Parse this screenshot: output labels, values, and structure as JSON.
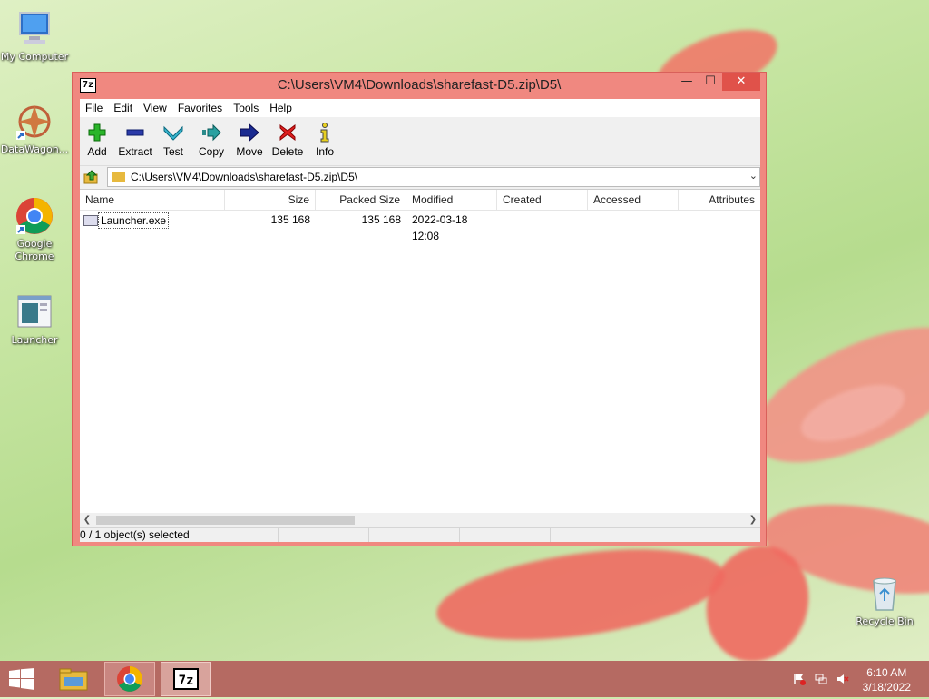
{
  "desktop": {
    "icons": [
      {
        "label": "My Computer"
      },
      {
        "label": "DataWagon..."
      },
      {
        "label": "Google Chrome"
      },
      {
        "label": "Launcher"
      },
      {
        "label": "Recycle Bin"
      }
    ]
  },
  "window": {
    "title": "C:\\Users\\VM4\\Downloads\\sharefast-D5.zip\\D5\\",
    "app_icon_text": "7z",
    "controls": {
      "minimize": "—",
      "maximize": "☐",
      "close": "✕"
    }
  },
  "menu": [
    "File",
    "Edit",
    "View",
    "Favorites",
    "Tools",
    "Help"
  ],
  "toolbar": [
    {
      "label": "Add",
      "icon": "plus-icon"
    },
    {
      "label": "Extract",
      "icon": "minus-icon"
    },
    {
      "label": "Test",
      "icon": "check-icon"
    },
    {
      "label": "Copy",
      "icon": "copy-arrow-icon"
    },
    {
      "label": "Move",
      "icon": "move-arrow-icon"
    },
    {
      "label": "Delete",
      "icon": "delete-x-icon"
    },
    {
      "label": "Info",
      "icon": "info-icon"
    }
  ],
  "address": {
    "path": "C:\\Users\\VM4\\Downloads\\sharefast-D5.zip\\D5\\"
  },
  "columns": [
    "Name",
    "Size",
    "Packed Size",
    "Modified",
    "Created",
    "Accessed",
    "Attributes"
  ],
  "rows": [
    {
      "name": "Launcher.exe",
      "size": "135 168",
      "packed": "135 168",
      "modified": "2022-03-18 12:08",
      "created": "",
      "accessed": "",
      "attributes": ""
    }
  ],
  "status": {
    "selection": "0 / 1 object(s) selected"
  },
  "taskbar": {
    "time": "6:10 AM",
    "date": "3/18/2022",
    "apps": [
      "File Explorer",
      "Google Chrome",
      "7-Zip"
    ]
  },
  "colors": {
    "window_frame": "#f08880",
    "close_button": "#e0524a",
    "taskbar": "#b56a62"
  }
}
